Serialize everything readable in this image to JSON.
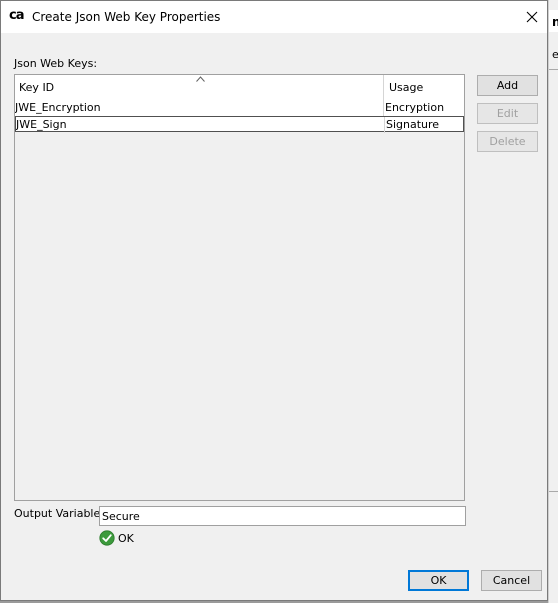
{
  "window": {
    "title": "Create Json Web Key Properties",
    "logo": "ca"
  },
  "group_label": "Json Web Keys:",
  "table": {
    "columns": [
      "Key ID",
      "Usage"
    ],
    "rows": [
      {
        "key_id": "JWE_Encryption",
        "usage": "Encryption"
      },
      {
        "key_id": "JWE_Sign",
        "usage": "Signature"
      }
    ]
  },
  "buttons": {
    "add": "Add",
    "edit": "Edit",
    "delete": "Delete",
    "ok": "OK",
    "cancel": "Cancel"
  },
  "output_variable": {
    "label": "Output Variable",
    "value": "Secure",
    "status": "OK"
  },
  "colors": {
    "dialog_bg": "#f0f0f0",
    "primary_border": "#0078d7",
    "ok_check": "#3c9a3c"
  }
}
